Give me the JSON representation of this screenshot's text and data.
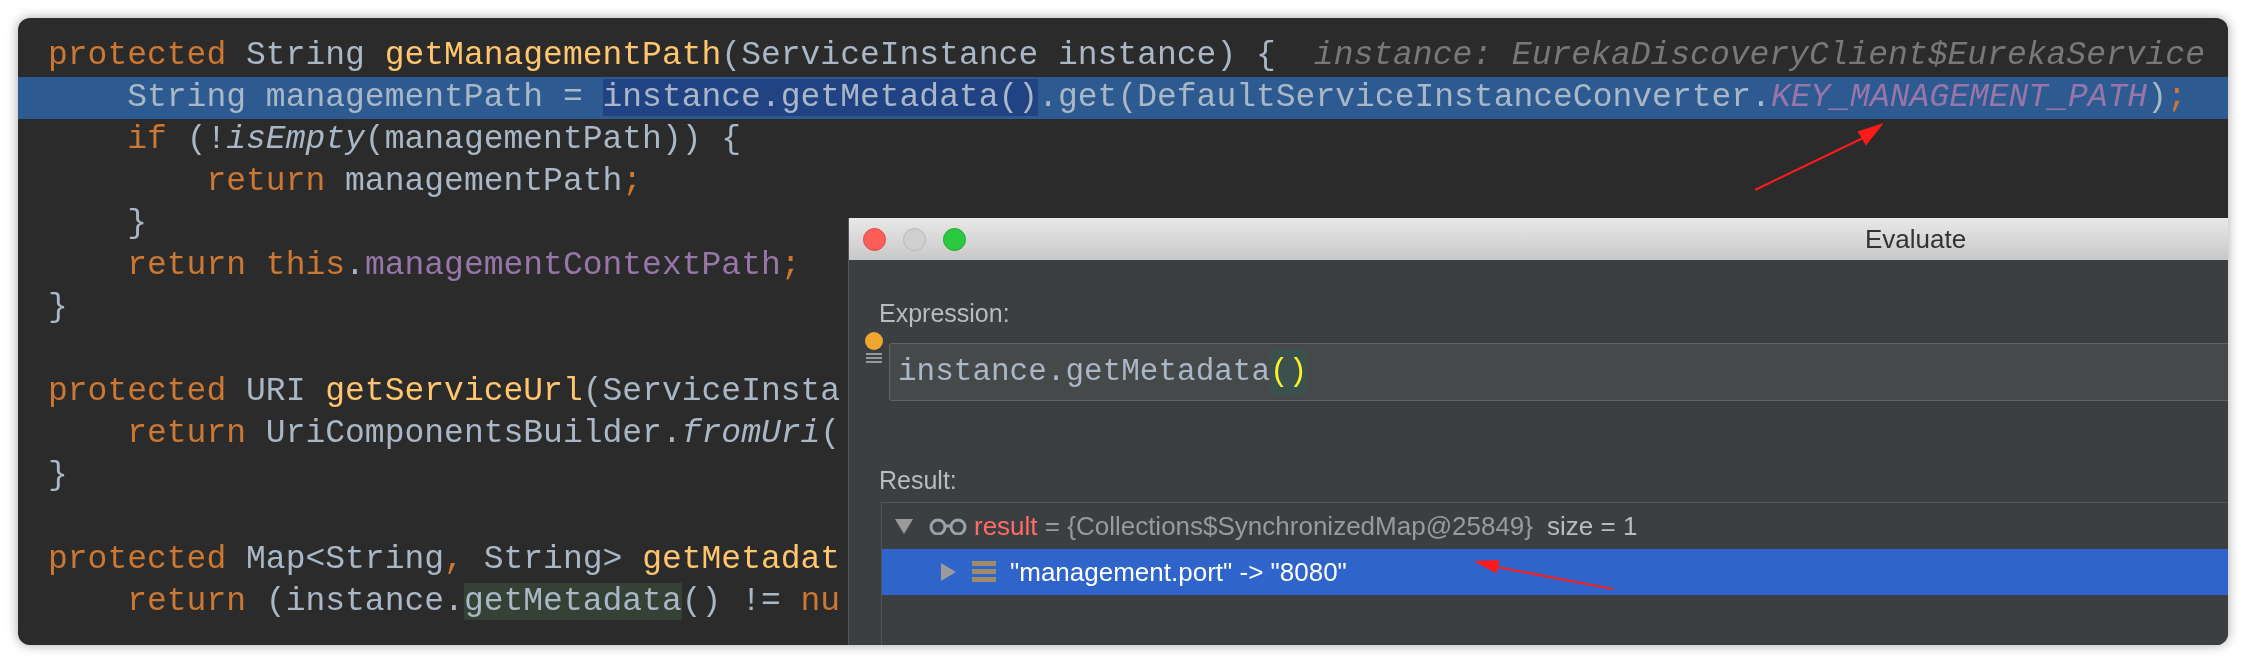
{
  "editor": {
    "lines": [
      {
        "selected": false,
        "tokens": [
          {
            "text": "protected ",
            "kind": "keyword"
          },
          {
            "text": "String ",
            "kind": "plain"
          },
          {
            "text": "getManagementPath",
            "kind": "method"
          },
          {
            "text": "(ServiceInstance instance) {",
            "kind": "plain"
          }
        ],
        "hint": "instance: EurekaDiscoveryClient$EurekaService"
      },
      {
        "selected": true,
        "tokens": [
          {
            "text": "    String managementPath = ",
            "kind": "plain"
          },
          {
            "text": "instance.getMetadata()",
            "kind": "plain",
            "match_highlighted": true
          },
          {
            "text": ".get(DefaultServiceInstanceConverter.",
            "kind": "plain"
          },
          {
            "text": "KEY_MANAGEMENT_PATH",
            "kind": "constant"
          },
          {
            "text": ")",
            "kind": "plain"
          },
          {
            "text": ";",
            "kind": "keyword"
          }
        ]
      },
      {
        "selected": false,
        "tokens": [
          {
            "text": "    if ",
            "kind": "keyword"
          },
          {
            "text": "(!",
            "kind": "plain"
          },
          {
            "text": "isEmpty",
            "kind": "static"
          },
          {
            "text": "(managementPath)) {",
            "kind": "plain"
          }
        ]
      },
      {
        "selected": false,
        "tokens": [
          {
            "text": "        return ",
            "kind": "keyword"
          },
          {
            "text": "managementPath",
            "kind": "plain"
          },
          {
            "text": ";",
            "kind": "keyword"
          }
        ]
      },
      {
        "selected": false,
        "tokens": [
          {
            "text": "    }",
            "kind": "plain"
          }
        ]
      },
      {
        "selected": false,
        "tokens": [
          {
            "text": "    return this",
            "kind": "keyword"
          },
          {
            "text": ".",
            "kind": "plain"
          },
          {
            "text": "managementContextPath",
            "kind": "field"
          },
          {
            "text": ";",
            "kind": "keyword"
          }
        ]
      },
      {
        "selected": false,
        "tokens": [
          {
            "text": "}",
            "kind": "plain"
          }
        ]
      },
      {
        "selected": false
      },
      {
        "selected": false,
        "tokens": [
          {
            "text": "protected ",
            "kind": "keyword"
          },
          {
            "text": "URI ",
            "kind": "plain"
          },
          {
            "text": "getServiceUrl",
            "kind": "method"
          },
          {
            "text": "(ServiceInsta",
            "kind": "plain"
          }
        ]
      },
      {
        "selected": false,
        "tokens": [
          {
            "text": "    return ",
            "kind": "keyword"
          },
          {
            "text": "UriComponentsBuilder.",
            "kind": "plain"
          },
          {
            "text": "fromUri",
            "kind": "static"
          },
          {
            "text": "(",
            "kind": "plain"
          }
        ]
      },
      {
        "selected": false,
        "tokens": [
          {
            "text": "}",
            "kind": "plain"
          }
        ]
      },
      {
        "selected": false
      },
      {
        "selected": false,
        "tokens": [
          {
            "text": "protected ",
            "kind": "keyword"
          },
          {
            "text": "Map<String",
            "kind": "plain"
          },
          {
            "text": ", ",
            "kind": "keyword"
          },
          {
            "text": "String> ",
            "kind": "plain"
          },
          {
            "text": "getMetadat",
            "kind": "method"
          }
        ]
      },
      {
        "selected": false,
        "tokens": [
          {
            "text": "    return ",
            "kind": "keyword"
          },
          {
            "text": "(instance.",
            "kind": "plain"
          },
          {
            "text": "getMetadata",
            "kind": "plain",
            "usage_highlighted": true
          },
          {
            "text": "() != ",
            "kind": "plain"
          },
          {
            "text": "nu",
            "kind": "keyword"
          }
        ]
      }
    ]
  },
  "evaluate_dialog": {
    "title": "Evaluate",
    "expression_label": "Expression:",
    "expression": [
      {
        "text": "instance.getMetadata",
        "kind": "plain"
      },
      {
        "text": "()",
        "kind": "brace_match"
      }
    ],
    "result_label": "Result:",
    "result_tree": [
      {
        "name": "result",
        "value": "= {Collections$SynchronizedMap@25849}",
        "size": "size = 1",
        "expanded": true,
        "selected": false,
        "children": [
          {
            "text": "\"management.port\" -> \"8080\"",
            "expanded": false,
            "selected": true
          }
        ]
      }
    ]
  }
}
